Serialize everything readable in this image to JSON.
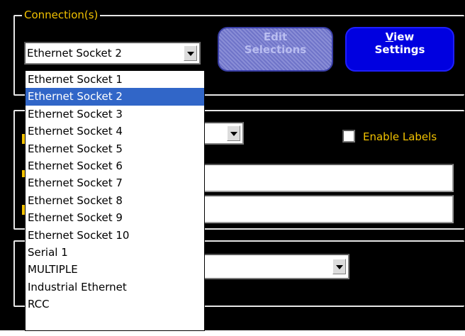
{
  "connections_group": {
    "legend": "Connection(s)",
    "selected_connection": "Ethernet Socket 2",
    "edit_selections_label_line1": "Edit",
    "edit_selections_label_line2": "Selections",
    "view_settings_label_line1_ul": "V",
    "view_settings_label_line1_rest": "iew",
    "view_settings_label_line2": "Settings"
  },
  "labels_group": {
    "enable_labels_label": "Enable Labels",
    "field_1_value": "",
    "field_2_value": ""
  },
  "third_group": {
    "combo_value": ""
  },
  "dropdown": {
    "highlighted_index": 1,
    "options": [
      "Ethernet Socket 1",
      "Ethernet Socket 2",
      "Ethernet Socket 3",
      "Ethernet Socket 4",
      "Ethernet Socket 5",
      "Ethernet Socket 6",
      "Ethernet Socket 7",
      "Ethernet Socket 8",
      "Ethernet Socket 9",
      "Ethernet Socket 10",
      "Serial 1",
      "MULTIPLE",
      "Industrial Ethernet",
      "RCC"
    ]
  },
  "colors": {
    "background": "#000000",
    "label_yellow": "#f2c200",
    "highlight_blue": "#3166c8",
    "view_button_blue": "#0000e0",
    "disabled_button": "#8a8ed6"
  }
}
